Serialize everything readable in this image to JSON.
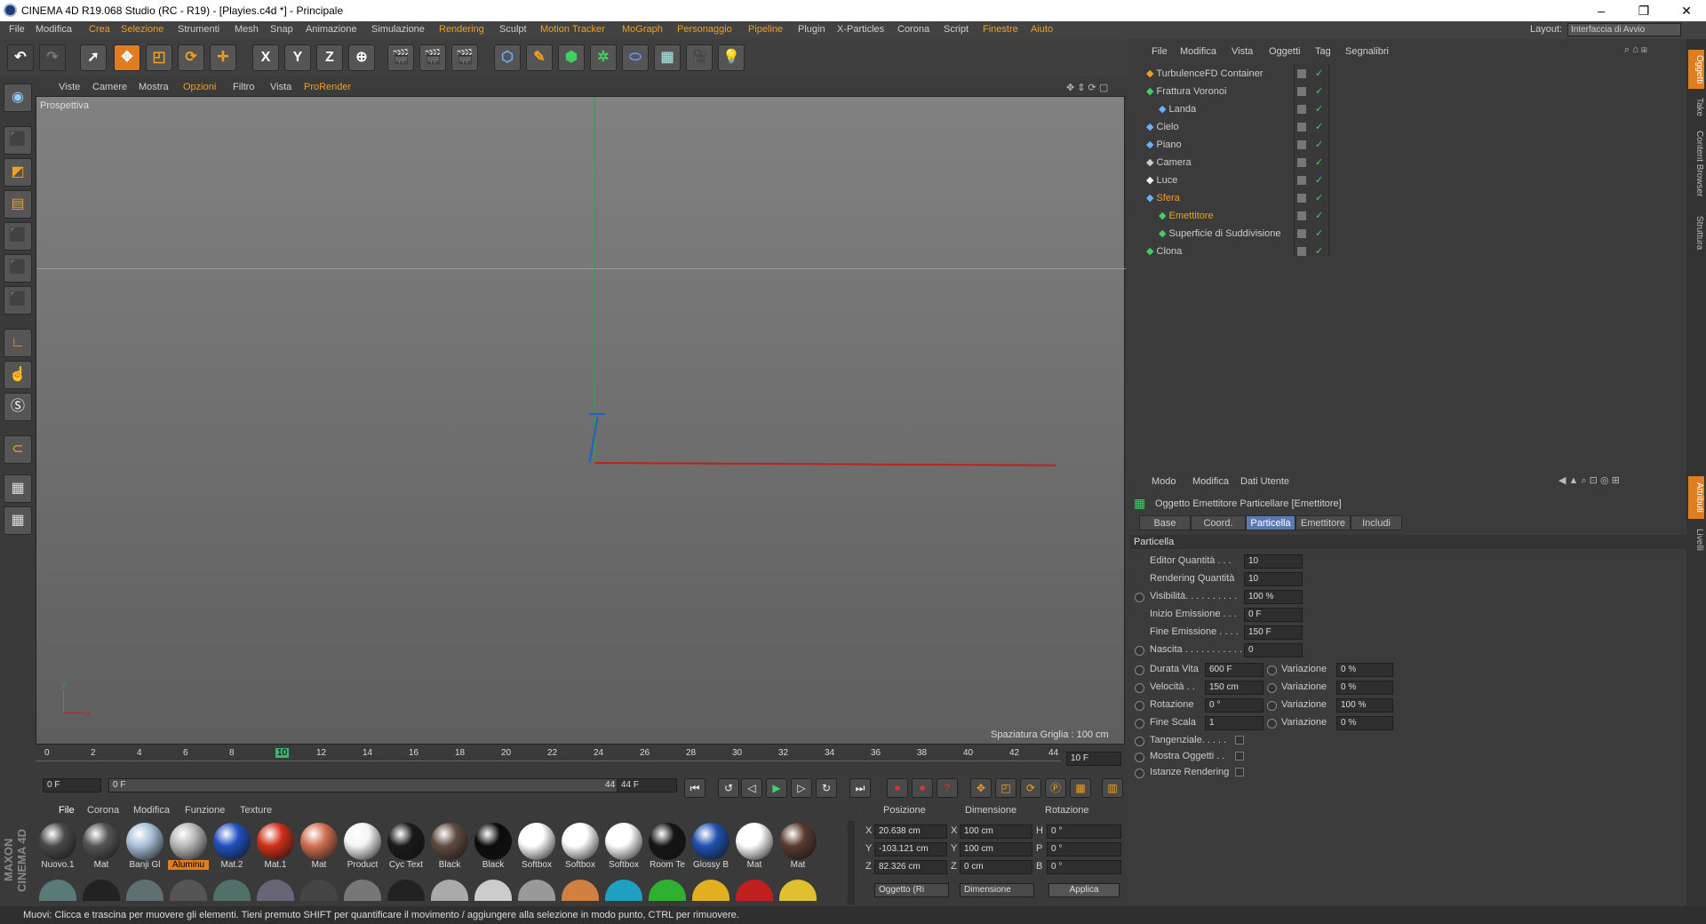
{
  "window": {
    "title": "CINEMA 4D R19.068 Studio (RC - R19) - [Playies.c4d *] - Principale",
    "minimize": "–",
    "maximize": "❐",
    "close": "✕"
  },
  "menu": {
    "items": [
      "File",
      "Modifica",
      "Crea",
      "Selezione",
      "Strumenti",
      "Mesh",
      "Snap",
      "Animazione",
      "Simulazione",
      "Rendering",
      "Sculpt",
      "Motion Tracker",
      "MoGraph",
      "Personaggio",
      "Pipeline",
      "Plugin",
      "X-Particles",
      "Corona",
      "Script",
      "Finestre",
      "Aiuto"
    ],
    "layout_label": "Layout:",
    "layout_value": "Interfaccia di Avvio"
  },
  "toolbar": {
    "axis_x": "X",
    "axis_y": "Y",
    "axis_z": "Z"
  },
  "viewport": {
    "menu": [
      "Viste",
      "Camere",
      "Mostra",
      "Opzioni",
      "Filtro",
      "Vista",
      "ProRender"
    ],
    "label": "Prospettiva",
    "grid_spacing": "Spaziatura Griglia : 100 cm",
    "axis_x": "x",
    "axis_y": "y"
  },
  "timeline": {
    "ticks": [
      "0",
      "2",
      "4",
      "6",
      "8",
      "10",
      "12",
      "14",
      "16",
      "18",
      "20",
      "22",
      "24",
      "26",
      "28",
      "30",
      "32",
      "34",
      "36",
      "38",
      "40",
      "42",
      "44"
    ],
    "current_frame": "10",
    "end_field": "10 F",
    "start_field": "0 F",
    "range_start": "0 F",
    "range_end": "44 F",
    "max_field": "44 F"
  },
  "materials": {
    "menu": [
      "File",
      "Corona",
      "Modifica",
      "Funzione",
      "Texture"
    ],
    "items": [
      {
        "name": "Nuovo.1",
        "color": "#4a4a4a"
      },
      {
        "name": "Mat",
        "color": "#555555"
      },
      {
        "name": "Banji Gl",
        "color": "#a8c0d8"
      },
      {
        "name": "Aluminu",
        "color": "#b8b8b8"
      },
      {
        "name": "Mat.2",
        "color": "#2050c0"
      },
      {
        "name": "Mat.1",
        "color": "#d03018"
      },
      {
        "name": "Mat",
        "color": "#d07050"
      },
      {
        "name": "Product",
        "color": "#f4f4f4"
      },
      {
        "name": "Cyc Text",
        "color": "#1a1a1a"
      },
      {
        "name": "Black",
        "color": "#604a40"
      },
      {
        "name": "Black",
        "color": "#0c0c0c"
      },
      {
        "name": "Softbox",
        "color": "#ffffff"
      },
      {
        "name": "Softbox",
        "color": "#ffffff"
      },
      {
        "name": "Softbox",
        "color": "#ffffff"
      },
      {
        "name": "Room Te",
        "color": "#151515"
      },
      {
        "name": "Glossy B",
        "color": "#2050b0"
      },
      {
        "name": "Mat",
        "color": "#ffffff"
      },
      {
        "name": "Mat",
        "color": "#5a3a30"
      }
    ]
  },
  "coords": {
    "headers": [
      "Posizione",
      "Dimensione",
      "Rotazione"
    ],
    "rows": [
      {
        "axis": "X",
        "pos": "20.638 cm",
        "daxis": "X",
        "dim": "100 cm",
        "raxis": "H",
        "rot": "0 °"
      },
      {
        "axis": "Y",
        "pos": "-103.121 cm",
        "daxis": "Y",
        "dim": "100 cm",
        "raxis": "P",
        "rot": "0 °"
      },
      {
        "axis": "Z",
        "pos": "82.326 cm",
        "daxis": "Z",
        "dim": "0 cm",
        "raxis": "B",
        "rot": "0 °"
      }
    ],
    "mode1": "Oggetto (Ri",
    "mode2": "Dimensione",
    "apply": "Applica"
  },
  "objects": {
    "menu": [
      "File",
      "Modifica",
      "Vista",
      "Oggetti",
      "Tag",
      "Segnalibri"
    ],
    "items": [
      {
        "name": "TurbulenceFD Container",
        "indent": 0
      },
      {
        "name": "Frattura Voronoi",
        "indent": 0
      },
      {
        "name": "Landa",
        "indent": 1
      },
      {
        "name": "Cielo",
        "indent": 0
      },
      {
        "name": "Piano",
        "indent": 0
      },
      {
        "name": "Camera",
        "indent": 0
      },
      {
        "name": "Luce",
        "indent": 0
      },
      {
        "name": "Sfera",
        "indent": 0
      },
      {
        "name": "Emettitore",
        "indent": 1
      },
      {
        "name": "Superficie di Suddivisione",
        "indent": 1
      },
      {
        "name": "Clona",
        "indent": 0
      }
    ]
  },
  "attributes": {
    "menu": [
      "Modo",
      "Modifica",
      "Dati Utente"
    ],
    "object_title": "Oggetto Emettitore Particellare [Emettitore]",
    "tabs": [
      "Base",
      "Coord.",
      "Particella",
      "Emettitore",
      "Includi"
    ],
    "section": "Particella",
    "rows": [
      {
        "label": "Editor Quantità . . .",
        "value": "10"
      },
      {
        "label": "Rendering Quantità",
        "value": "10"
      },
      {
        "label": "Visibilità. . . . . . . . . .",
        "value": "100 %"
      },
      {
        "label": "Inizio Emissione . . .",
        "value": "0 F"
      },
      {
        "label": "Fine Emissione . . . .",
        "value": "150 F"
      },
      {
        "label": "Nascita . . . . . . . . . . .",
        "value": "0"
      }
    ],
    "var_rows": [
      {
        "label": "Durata Vita",
        "value": "600 F",
        "var_label": "Variazione",
        "var": "0 %"
      },
      {
        "label": "Velocità . .",
        "value": "150 cm",
        "var_label": "Variazione",
        "var": "0 %"
      },
      {
        "label": "Rotazione",
        "value": "0 °",
        "var_label": "Variazione",
        "var": "100 %"
      },
      {
        "label": "Fine Scala",
        "value": "1",
        "var_label": "Variazione",
        "var": "0 %"
      }
    ],
    "checks": [
      {
        "label": "Tangenziale. . . . ."
      },
      {
        "label": "Mostra Oggetti . ."
      },
      {
        "label": "Istanze Rendering"
      }
    ]
  },
  "side_tabs": [
    "Oggetti",
    "Take",
    "Content Browser",
    "Struttura",
    "Attributi",
    "Livelli"
  ],
  "status": "Muovi: Clicca e trascina per muovere gli elementi. Tieni premuto SHIFT per quantificare il movimento / aggiungere alla selezione in modo punto, CTRL per rimuovere.",
  "colors": {
    "accent": "#e07d20",
    "selected_tab": "#5a7ab0",
    "menu_highlight": "#f0a020"
  }
}
